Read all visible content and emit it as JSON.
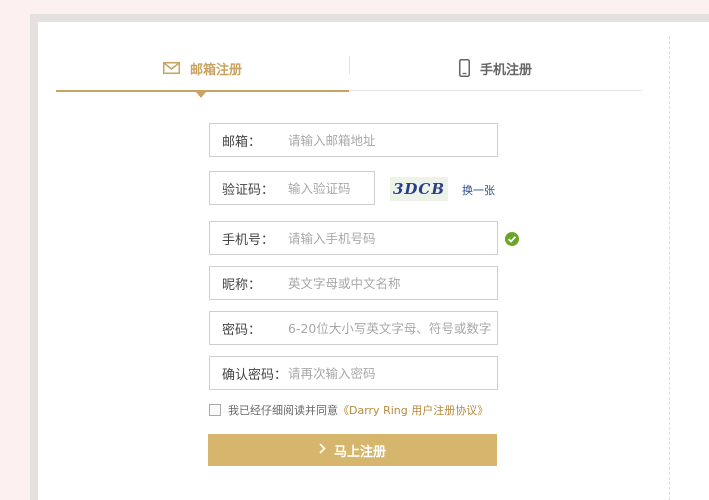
{
  "tabs": {
    "email": {
      "label": "邮箱注册",
      "icon": "envelope-icon"
    },
    "phone": {
      "label": "手机注册",
      "icon": "mobile-phone-icon"
    }
  },
  "form": {
    "email": {
      "label": "邮箱：",
      "placeholder": "请输入邮箱地址"
    },
    "captcha": {
      "label": "验证码：",
      "placeholder": "输入验证码",
      "image_text": "3DCB",
      "refresh": "换一张"
    },
    "phone": {
      "label": "手机号：",
      "placeholder": "请输入手机号码",
      "status_icon": "check-circle-icon"
    },
    "nickname": {
      "label": "昵称：",
      "placeholder": "英文字母或中文名称"
    },
    "password": {
      "label": "密码：",
      "placeholder": "6-20位大小写英文字母、符号或数字"
    },
    "confirm": {
      "label": "确认密码：",
      "placeholder": "请再次输入密码"
    }
  },
  "agreement": {
    "prefix": "我已经仔细阅读并同意",
    "link": "《Darry Ring 用户注册协议》"
  },
  "submit": {
    "label": "马上注册",
    "icon": "chevron-right-icon"
  },
  "colors": {
    "accent": "#c9a460",
    "button": "#d6b66c",
    "success": "#6aa728",
    "background": "#fdf0f0"
  }
}
